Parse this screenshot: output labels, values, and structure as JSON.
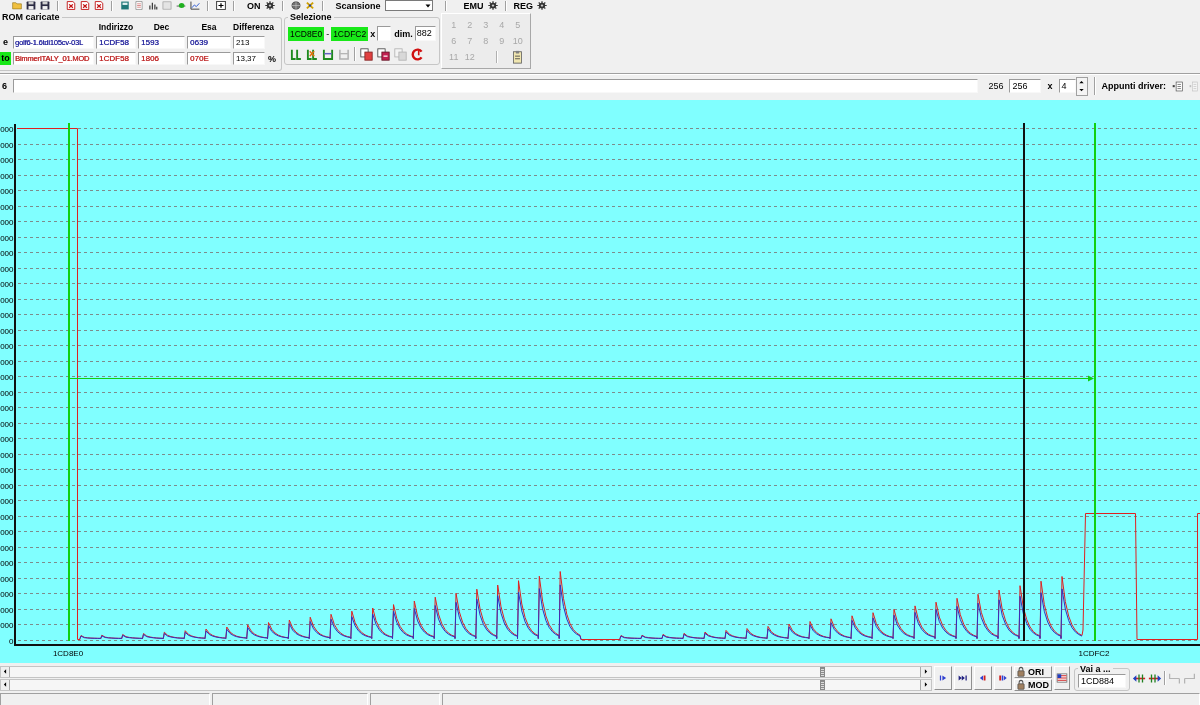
{
  "toolbar": {
    "on_label": "ON",
    "scan_label": "Scansione",
    "emu_label": "EMU",
    "reg_label": "REG"
  },
  "rom_panel": {
    "title": "ROM caricate",
    "columns": [
      "Indirizzo",
      "Dec",
      "Esa",
      "Differenza"
    ],
    "rows": [
      {
        "label": "e",
        "active": false,
        "color": "#2a2aa0",
        "file": "golf6-1.6tdi105cv-03L",
        "address": "1CDF58",
        "dec": "1593",
        "hex": "0639",
        "difference": "213"
      },
      {
        "label": "to",
        "active": true,
        "color": "#c02828",
        "file": "BimmerITALY_01.MOD",
        "address": "1CDF58",
        "dec": "1806",
        "hex": "070E",
        "difference": "13,37",
        "unit": "%"
      }
    ]
  },
  "selection": {
    "title": "Selezione",
    "start": "1CD8E0",
    "separator": "-",
    "end": "1CDFC2",
    "x_label": "x",
    "dim_label": "dim.",
    "dim": "882"
  },
  "slots": [
    {
      "label": "1",
      "disabled": true
    },
    {
      "label": "2",
      "disabled": true
    },
    {
      "label": "3",
      "disabled": true
    },
    {
      "label": "4",
      "disabled": true
    },
    {
      "label": "5",
      "disabled": true
    },
    {
      "label": "6",
      "disabled": true
    },
    {
      "label": "7",
      "disabled": true
    },
    {
      "label": "8",
      "disabled": true
    },
    {
      "label": "9",
      "disabled": true
    },
    {
      "label": "10",
      "disabled": true
    },
    {
      "label": "11",
      "disabled": true
    },
    {
      "label": "12",
      "disabled": true
    }
  ],
  "range_bar": {
    "label": "6",
    "count": "256",
    "size": "256",
    "x_label": "x",
    "multiplier": "4",
    "clipboard_label": "Appunti driver:"
  },
  "chart": {
    "y_labels": [
      "000",
      "000",
      "000",
      "000",
      "000",
      "000",
      "000",
      "000",
      "000",
      "000",
      "000",
      "000",
      "000",
      "000",
      "000",
      "000",
      "000",
      "000",
      "000",
      "000",
      "000",
      "000",
      "000",
      "000",
      "000",
      "000",
      "000",
      "000",
      "000",
      "000",
      "000",
      "000",
      "000",
      "0"
    ],
    "x_labels": [
      "1CD8E0",
      "1CDFC2"
    ]
  },
  "navigation": {
    "ori_label": "ORI",
    "mod_label": "MOD",
    "goto": {
      "title": "Vai a ...",
      "value": "1CD884"
    }
  }
}
